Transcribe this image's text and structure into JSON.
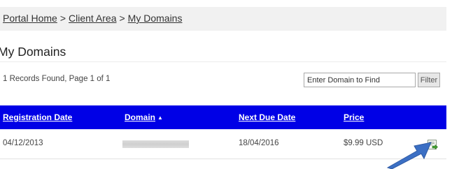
{
  "breadcrumb": {
    "items": [
      "Portal Home",
      "Client Area",
      "My Domains"
    ],
    "separator": ">"
  },
  "page": {
    "title": "My Domains"
  },
  "toolbar": {
    "records_text": "1 Records Found, Page 1 of 1",
    "search_placeholder": "Enter Domain to Find",
    "filter_label": "Filter"
  },
  "table": {
    "columns": [
      "Registration Date",
      "Domain",
      "Next Due Date",
      "Price"
    ],
    "sort_indicator": "▲",
    "header_color": "#0000e6",
    "rows": [
      {
        "registration_date": "04/12/2013",
        "domain": "",
        "next_due_date": "18/04/2016",
        "price": "$9.99 USD"
      }
    ]
  },
  "icons": {
    "row_action": "manage-domain-icon",
    "annotation": "pointer-arrow-icon"
  },
  "colors": {
    "annotation_arrow": "#3b6fc4"
  }
}
